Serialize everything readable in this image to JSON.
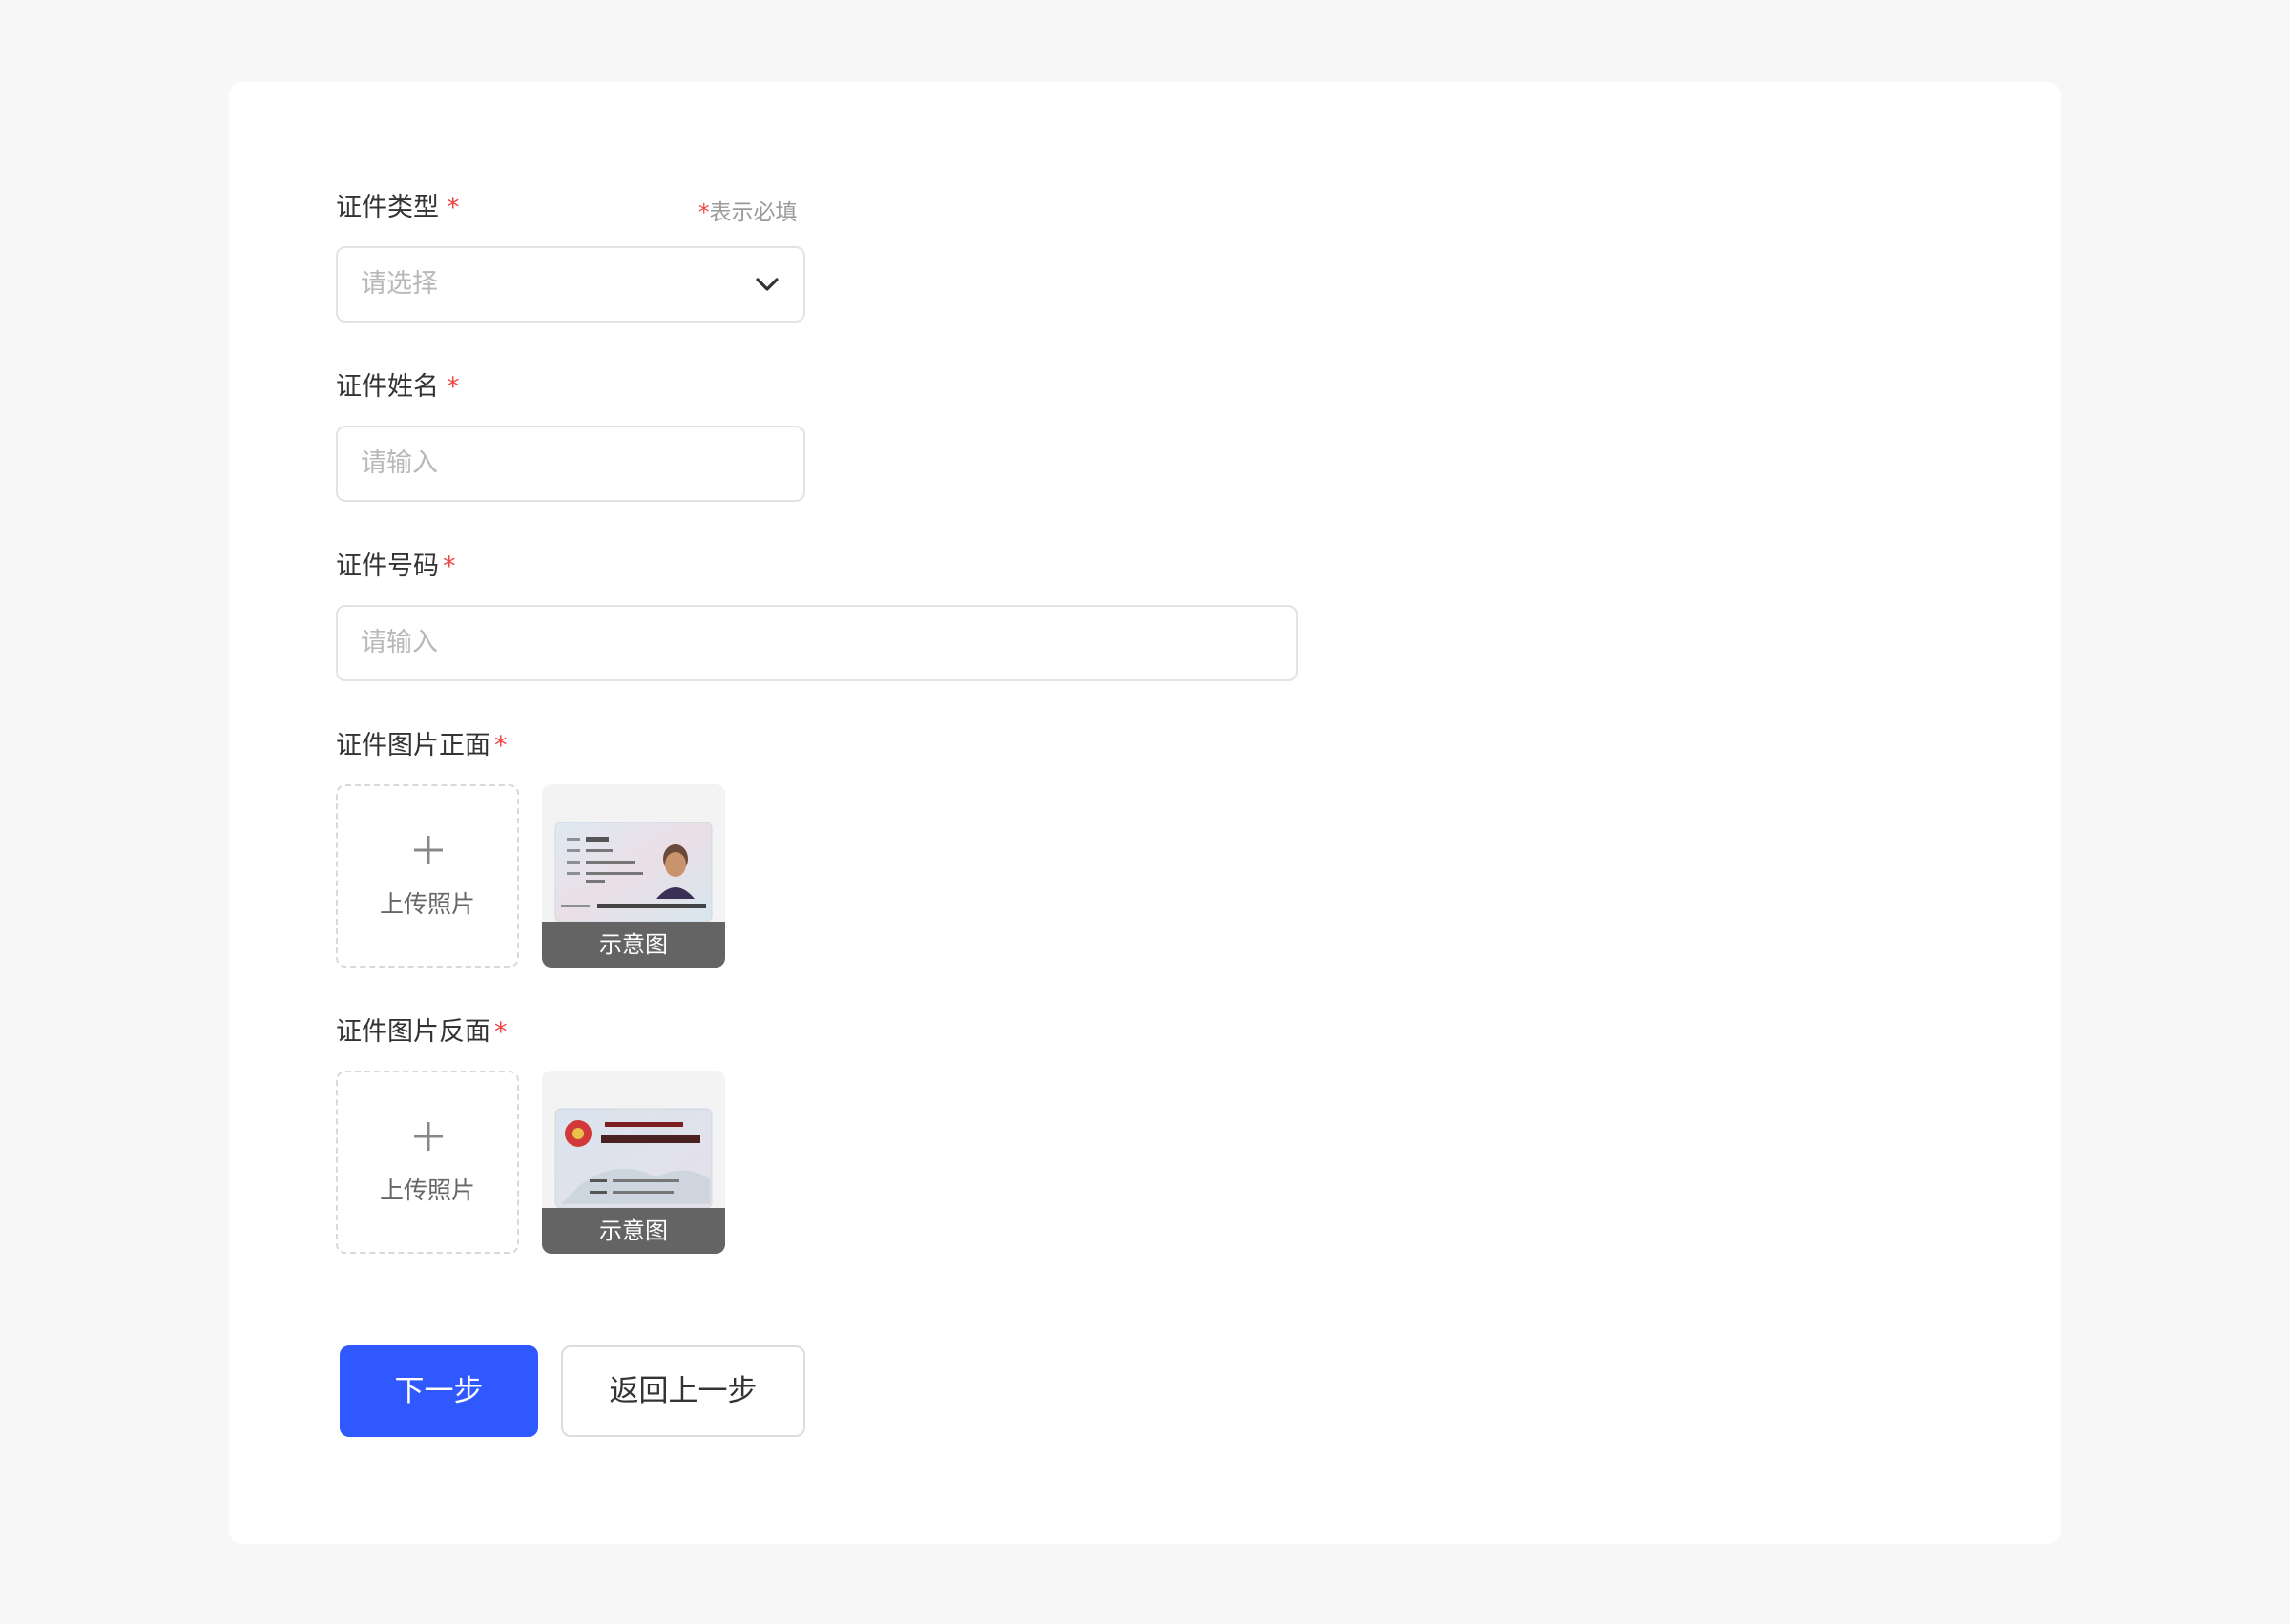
{
  "legend": {
    "star": "*",
    "text": "表示必填"
  },
  "fields": {
    "cert_type": {
      "label": "证件类型",
      "required_mark": "*",
      "placeholder": "请选择"
    },
    "cert_name": {
      "label": "证件姓名",
      "required_mark": "*",
      "placeholder": "请输入"
    },
    "cert_number": {
      "label": "证件号码",
      "required_mark": "*",
      "placeholder": "请输入"
    }
  },
  "photos": {
    "front": {
      "label": "证件图片正面",
      "required_mark": "*",
      "upload_label": "上传照片",
      "sample_caption": "示意图"
    },
    "back": {
      "label": "证件图片反面",
      "required_mark": "*",
      "upload_label": "上传照片",
      "sample_caption": "示意图"
    }
  },
  "buttons": {
    "next": "下一步",
    "back": "返回上一步"
  },
  "colors": {
    "primary": "#2f58ff",
    "required": "#f04545",
    "background": "#f7f7f7"
  },
  "icons": {
    "dropdown": "chevron-down-icon",
    "upload": "plus-icon"
  }
}
